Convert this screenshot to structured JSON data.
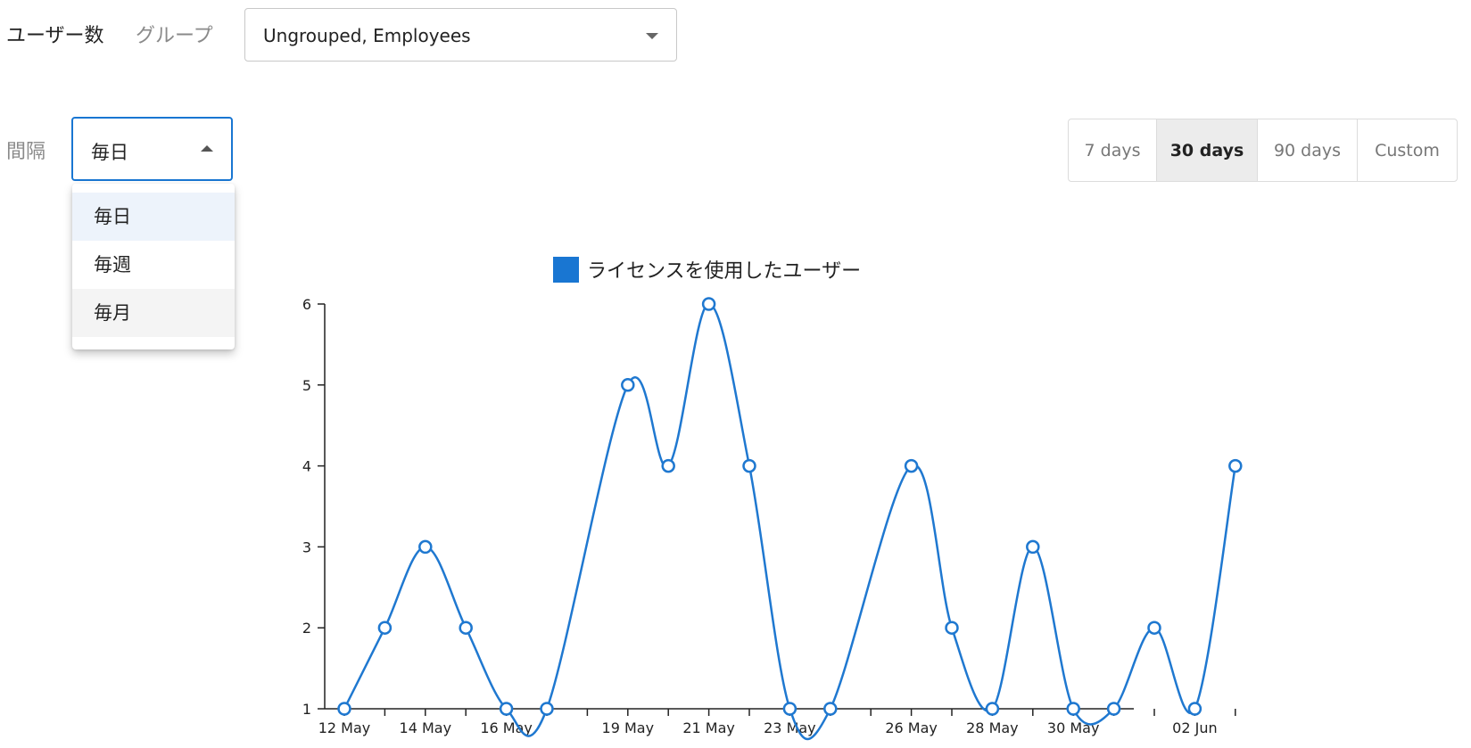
{
  "header": {
    "title": "ユーザー数",
    "group_label": "グループ",
    "group_value": "Ungrouped, Employees"
  },
  "interval": {
    "label": "間隔",
    "value": "毎日",
    "options": [
      "毎日",
      "毎週",
      "毎月"
    ]
  },
  "range_buttons": [
    "7 days",
    "30 days",
    "90 days",
    "Custom"
  ],
  "range_selected": "30 days",
  "colors": {
    "accent": "#1976d2",
    "line": "#1f78d0"
  },
  "chart_data": {
    "type": "line",
    "legend": "ライセンスを使用したユーザー",
    "legend_position": "top",
    "grid": false,
    "x_tick_labels": [
      "12 May",
      "14 May",
      "16 May",
      "19 May",
      "21 May",
      "23 May",
      "26 May",
      "28 May",
      "30 May",
      "02 Jun"
    ],
    "y_ticks": [
      1,
      2,
      3,
      4,
      5,
      6
    ],
    "ylim": [
      1,
      6
    ],
    "series": [
      {
        "name": "ライセンスを使用したユーザー",
        "points": [
          {
            "x": "12 May",
            "y": 1
          },
          {
            "x": "13 May",
            "y": 2
          },
          {
            "x": "14 May",
            "y": 3
          },
          {
            "x": "15 May",
            "y": 2
          },
          {
            "x": "16 May",
            "y": 1
          },
          {
            "x": "17 May",
            "y": 1
          },
          {
            "x": "19 May",
            "y": 5
          },
          {
            "x": "20 May",
            "y": 4
          },
          {
            "x": "21 May",
            "y": 6
          },
          {
            "x": "22 May",
            "y": 4
          },
          {
            "x": "23 May",
            "y": 1
          },
          {
            "x": "24 May",
            "y": 1
          },
          {
            "x": "26 May",
            "y": 4
          },
          {
            "x": "27 May",
            "y": 2
          },
          {
            "x": "28 May",
            "y": 1
          },
          {
            "x": "29 May",
            "y": 3
          },
          {
            "x": "30 May",
            "y": 1
          },
          {
            "x": "31 May",
            "y": 1
          },
          {
            "x": "01 Jun",
            "y": 2
          },
          {
            "x": "02 Jun",
            "y": 1
          },
          {
            "x": "03 Jun",
            "y": 4
          }
        ]
      }
    ]
  }
}
